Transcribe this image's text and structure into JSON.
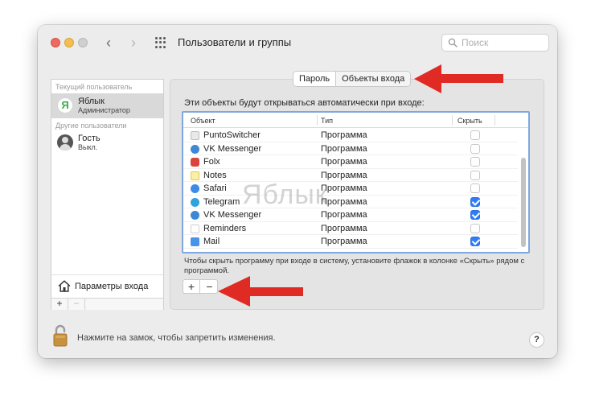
{
  "window": {
    "title": "Пользователи и группы",
    "search_placeholder": "Поиск"
  },
  "sidebar": {
    "current_header": "Текущий пользователь",
    "other_header": "Другие пользователи",
    "users": [
      {
        "name": "Яблык",
        "role": "Администратор",
        "avatar_letter": "Я"
      },
      {
        "name": "Гость",
        "role": "Выкл."
      }
    ],
    "login_options": "Параметры входа",
    "add": "+",
    "remove": "−"
  },
  "tabs": [
    {
      "label": "Пароль"
    },
    {
      "label": "Объекты входа"
    }
  ],
  "intro": "Эти объекты будут открываться автоматически при входе:",
  "table": {
    "columns": [
      "Объект",
      "Тип",
      "Скрыть"
    ],
    "rows": [
      {
        "name": "PuntoSwitcher",
        "type": "Программа",
        "hide": false,
        "icon": "puntoswitcher-icon"
      },
      {
        "name": "VK Messenger",
        "type": "Программа",
        "hide": false,
        "icon": "vk-messenger-icon"
      },
      {
        "name": "Folx",
        "type": "Программа",
        "hide": false,
        "icon": "folx-icon"
      },
      {
        "name": "Notes",
        "type": "Программа",
        "hide": false,
        "icon": "notes-icon"
      },
      {
        "name": "Safari",
        "type": "Программа",
        "hide": false,
        "icon": "safari-icon"
      },
      {
        "name": "Telegram",
        "type": "Программа",
        "hide": true,
        "icon": "telegram-icon"
      },
      {
        "name": "VK Messenger",
        "type": "Программа",
        "hide": true,
        "icon": "vk-messenger-icon"
      },
      {
        "name": "Reminders",
        "type": "Программа",
        "hide": false,
        "icon": "reminders-icon"
      },
      {
        "name": "Mail",
        "type": "Программа",
        "hide": true,
        "icon": "mail-icon"
      }
    ]
  },
  "hint": "Чтобы скрыть программу при входе в систему, установите флажок в колонке «Скрыть» рядом с программой.",
  "buttons": {
    "plus": "+",
    "minus": "−"
  },
  "watermark": "Яблык",
  "lock_text": "Нажмите на замок, чтобы запретить изменения.",
  "help": "?",
  "colors": {
    "accent": "#2f7cf6",
    "arrow": "#e02b24"
  }
}
